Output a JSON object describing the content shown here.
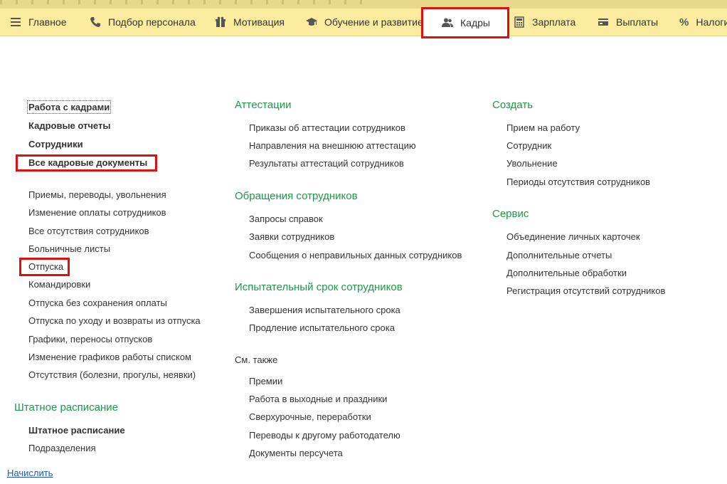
{
  "topnav": {
    "items": [
      {
        "label": "Главное",
        "icon": "menu-icon"
      },
      {
        "label": "Подбор персонала",
        "icon": "phone-icon"
      },
      {
        "label": "Мотивация",
        "icon": "gift-icon"
      },
      {
        "label": "Обучение и развитие",
        "icon": "graduation-cap-icon"
      },
      {
        "label": "Кадры",
        "icon": "users-icon"
      },
      {
        "label": "Зарплата",
        "icon": "calculator-icon"
      },
      {
        "label": "Выплаты",
        "icon": "wallet-icon"
      },
      {
        "label": "Налоги",
        "icon": "percent-icon"
      }
    ],
    "active": "Кадры"
  },
  "col1": {
    "main_links": [
      "Работа с кадрами",
      "Кадровые отчеты",
      "Сотрудники",
      "Все кадровые документы"
    ],
    "doc_links": [
      "Приемы, переводы, увольнения",
      "Изменение оплаты сотрудников",
      "Все отсутствия сотрудников",
      "Больничные листы",
      "Отпуска",
      "Командировки",
      "Отпуска без сохранения оплаты",
      "Отпуска по уходу и возвраты из отпуска",
      "Графики, переносы отпусков",
      "Изменение графиков работы списком",
      "Отсутствия (болезни, прогулы, неявки)"
    ],
    "staffing": {
      "heading": "Штатное расписание",
      "links": [
        "Штатное расписание",
        "Подразделения"
      ]
    }
  },
  "col2": {
    "attestations": {
      "heading": "Аттестации",
      "links": [
        "Приказы об аттестации сотрудников",
        "Направления на внешнюю аттестацию",
        "Результаты аттестаций сотрудников"
      ]
    },
    "requests": {
      "heading": "Обращения сотрудников",
      "links": [
        "Запросы справок",
        "Заявки сотрудников",
        "Сообщения о неправильных данных сотрудников"
      ]
    },
    "probation": {
      "heading": "Испытательный срок сотрудников",
      "links": [
        "Завершения испытательного срока",
        "Продление испытательного срока"
      ]
    },
    "see_also": {
      "heading": "См. также",
      "links": [
        "Премии",
        "Работа в выходные и праздники",
        "Сверхурочные, переработки",
        "Переводы к другому работодателю",
        "Документы персучета"
      ]
    }
  },
  "col3": {
    "create": {
      "heading": "Создать",
      "links": [
        "Прием на работу",
        "Сотрудник",
        "Увольнение",
        "Периоды отсутствия сотрудников"
      ]
    },
    "service": {
      "heading": "Сервис",
      "links": [
        "Объединение личных карточек",
        "Дополнительные отчеты",
        "Дополнительные обработки",
        "Регистрация отсутствий сотрудников"
      ]
    }
  },
  "footer": {
    "link": "Начислить"
  },
  "colors": {
    "nav_bg": "#fbec9f",
    "section_heading": "#1b9a45",
    "highlight": "#e01010",
    "link": "#1c56c9"
  }
}
